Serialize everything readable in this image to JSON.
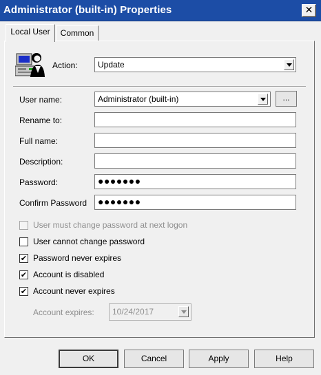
{
  "window": {
    "title": "Administrator (built-in) Properties",
    "close_glyph": "✕"
  },
  "tabs": [
    {
      "label": "Local User",
      "active": true
    },
    {
      "label": "Common",
      "active": false
    }
  ],
  "action": {
    "label": "Action:",
    "value": "Update",
    "icon": "computer-user-icon"
  },
  "form": {
    "username_label": "User name:",
    "username_value": "Administrator (built-in)",
    "browse_label": "...",
    "rename_label": "Rename to:",
    "rename_value": "",
    "fullname_label": "Full name:",
    "fullname_value": "",
    "description_label": "Description:",
    "description_value": "",
    "password_label": "Password:",
    "password_value": "●●●●●●●",
    "confirm_label": "Confirm Password",
    "confirm_value": "●●●●●●●"
  },
  "options": [
    {
      "label": "User must change password at next logon",
      "checked": false,
      "enabled": false
    },
    {
      "label": "User cannot change password",
      "checked": false,
      "enabled": true
    },
    {
      "label": "Password never expires",
      "checked": true,
      "enabled": true
    },
    {
      "label": "Account is disabled",
      "checked": true,
      "enabled": true
    },
    {
      "label": "Account never expires",
      "checked": true,
      "enabled": true
    }
  ],
  "expires": {
    "label": "Account expires:",
    "value": "10/24/2017",
    "enabled": false
  },
  "buttons": {
    "ok": "OK",
    "cancel": "Cancel",
    "apply": "Apply",
    "help": "Help"
  },
  "check_glyph": "✔",
  "colors": {
    "titlebar": "#1c4da6",
    "face": "#f0f0f0"
  }
}
